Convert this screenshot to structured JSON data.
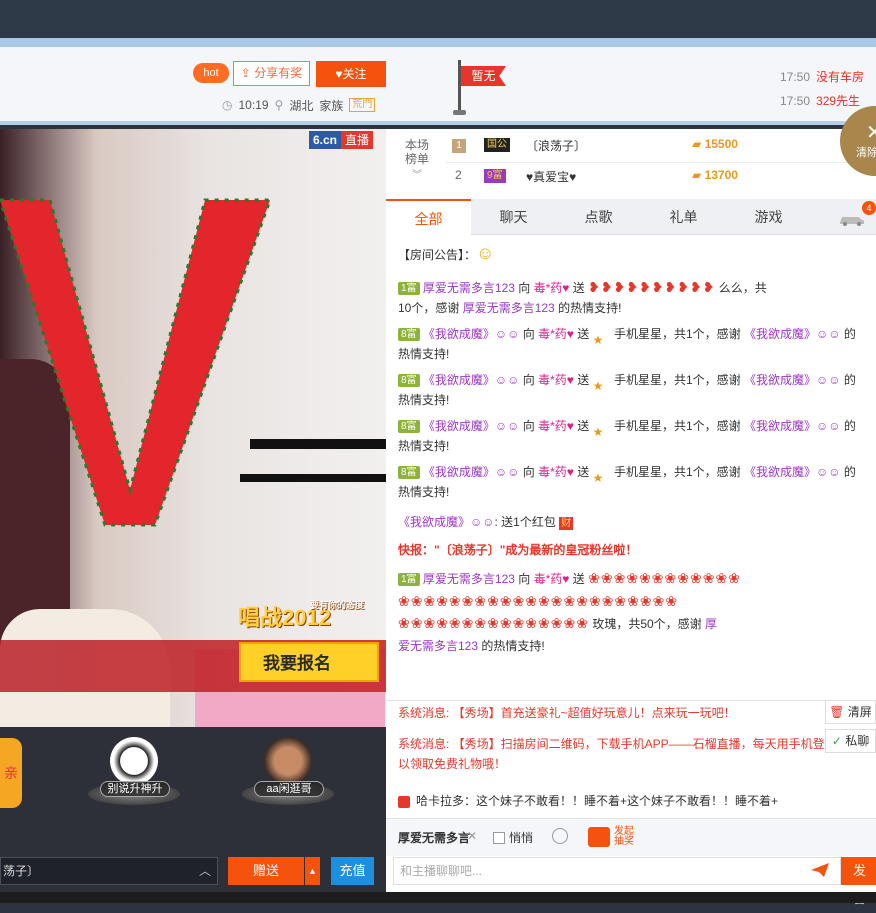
{
  "header": {
    "hot": "hot",
    "share_label": "分享有奖",
    "follow_label": "关注",
    "time": "10:19",
    "location": "湖北",
    "family": "家族",
    "family_badge": "荒門",
    "flag_label": "暂无",
    "logs": [
      {
        "time": "17:50",
        "who": "没有车房"
      },
      {
        "time": "17:50",
        "who": "329先生"
      }
    ],
    "clear_label": "清除"
  },
  "video": {
    "brand": "6.cn",
    "live_label": "直播",
    "contest_title": "唱战2012",
    "contest_sub": "要有你的态度",
    "signup_label": "我要报名"
  },
  "ranking_board": {
    "label": "本场榜单",
    "rows": [
      {
        "rank": "1",
        "title": "国公",
        "name": "〔浪荡子〕",
        "coins": "15500"
      },
      {
        "rank": "2",
        "title": "9富",
        "name": "♥真爱宝♥",
        "coins": "13700"
      }
    ]
  },
  "tabs": [
    "全部",
    "聊天",
    "点歌",
    "礼单",
    "游戏"
  ],
  "car_badge": "4",
  "chat": {
    "announcement_label": "【房间公告】：",
    "messages": [
      {
        "level": "1富",
        "from": "厚爱无需多言123",
        "verb": "向",
        "to": "毒*药♥",
        "send": "送",
        "gift": "",
        "tail": "么么，共",
        "line2_pre": "10个，感谢",
        "line2_user": "厚爱无需多言123",
        "line2_tail": "的热情支持!"
      },
      {
        "level": "8富",
        "from": "《我欲成魔》☺☺",
        "verb": "向",
        "to": "毒*药♥",
        "send": "送",
        "gift": "手机星星，共1个，感谢",
        "tail_user": "《我欲成魔》☺☺",
        "tail": "的",
        "line2": "热情支持!"
      },
      {
        "level": "8富",
        "from": "《我欲成魔》☺☺",
        "verb": "向",
        "to": "毒*药♥",
        "send": "送",
        "gift": "手机星星，共1个，感谢",
        "tail_user": "《我欲成魔》☺☺",
        "tail": "的",
        "line2": "热情支持!"
      },
      {
        "level": "8富",
        "from": "《我欲成魔》☺☺",
        "verb": "向",
        "to": "毒*药♥",
        "send": "送",
        "gift": "手机星星，共1个，感谢",
        "tail_user": "《我欲成魔》☺☺",
        "tail": "的",
        "line2": "热情支持!"
      },
      {
        "level": "8富",
        "from": "《我欲成魔》☺☺",
        "verb": "向",
        "to": "毒*药♥",
        "send": "送",
        "gift": "手机星星，共1个，感谢",
        "tail_user": "《我欲成魔》☺☺",
        "tail": "的",
        "line2": "热情支持!"
      }
    ],
    "redpacket": {
      "user": "《我欲成魔》☺☺",
      "text": ": 送1个红包",
      "badge": "财"
    },
    "flash": {
      "label": "快报：",
      "text": "\"〔浪荡子〕\"成为最新的皇冠粉丝啦！"
    },
    "roses_msg": {
      "level": "1富",
      "from": "厚爱无需多言123",
      "verb": "向",
      "to": "毒*药♥",
      "send": "送",
      "tail": "玫瑰，共50个，感谢",
      "tail_user": "厚",
      "line3_user": "爱无需多言123",
      "line3_tail": "的热情支持!"
    },
    "system1": "系统消息: 【秀场】首充送豪礼~超值好玩意儿！点来玩一玩吧！",
    "system2a": "系统消息: 【秀场】扫描房间二维码，下载手机APP——石榴直播，每天用手机登",
    "system2b": "以领取免费礼物哦！",
    "clear_screen": "清屏",
    "private_chat": "私聊",
    "bulletin": "哈卡拉多：这个妹子不敢看！！睡不着+这个妹子不敢看！！睡不着+"
  },
  "input": {
    "to_user": "厚爱无需多言",
    "whisper_label": "悄悄",
    "lottery_label_1": "发起",
    "lottery_label_2": "抽奖",
    "placeholder": "和主播聊聊吧...",
    "send_label": "发言"
  },
  "bottom": {
    "ranks": [
      {
        "name": "别说升神升"
      },
      {
        "name": "aa闲逛哥"
      }
    ],
    "gift_target": "荡子〕",
    "gift_btn": "赠送",
    "recharge_btn": "充值"
  }
}
